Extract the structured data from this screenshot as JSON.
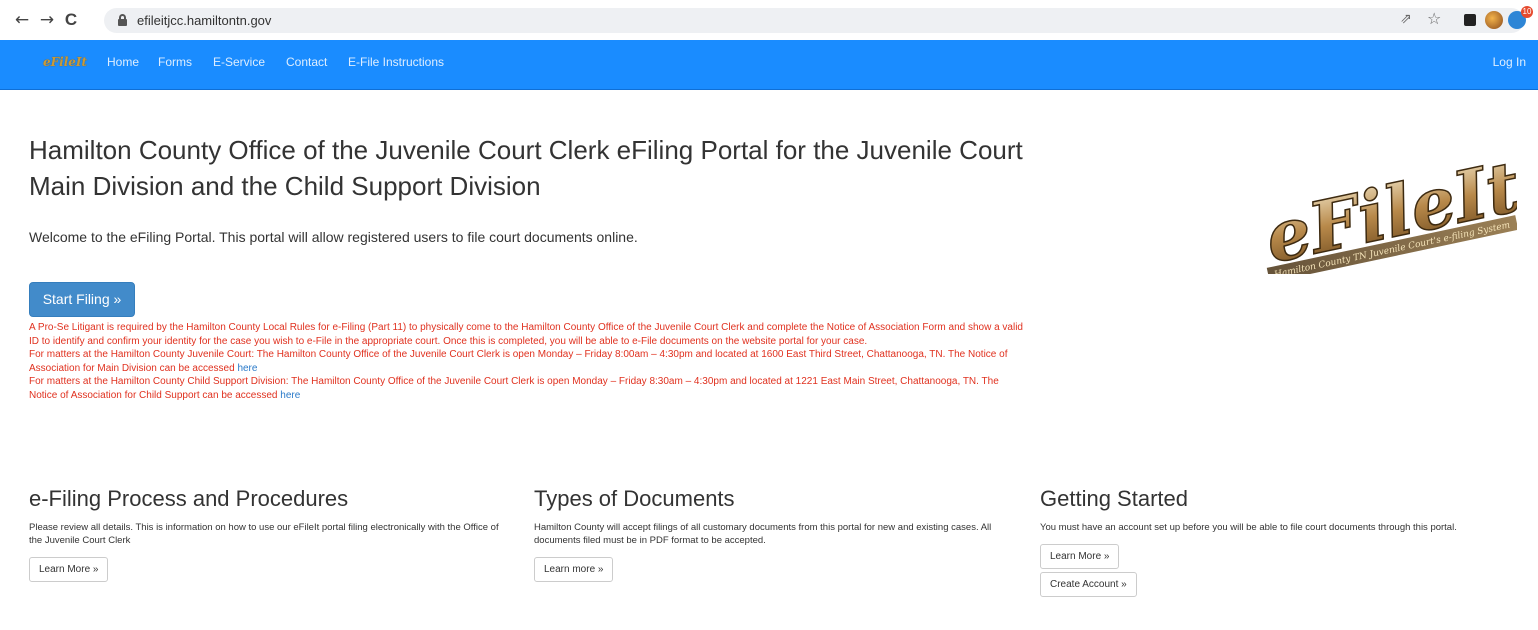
{
  "browser": {
    "url": "efileitjcc.hamiltontn.gov",
    "back": "←",
    "forward": "→",
    "reload": "C",
    "share": "⇗",
    "star": "☆",
    "ext_badge": "10"
  },
  "navbar": {
    "brand": "eFileIt",
    "links": [
      "Home",
      "Forms",
      "E-Service",
      "Contact",
      "E-File Instructions"
    ],
    "login": "Log In",
    "color": "#1a8cff"
  },
  "main": {
    "headline": "Hamilton County Office of the Juvenile Court Clerk eFiling Portal for the Juvenile Court Main Division and the Child Support Division",
    "welcome": "Welcome to the eFiling Portal. This portal will allow registered users to file court documents online.",
    "start_button": "Start Filing »",
    "notice": {
      "p1": "A Pro-Se Litigant is required by the Hamilton County Local Rules for e-Filing (Part 11) to physically come to the Hamilton County Office of the Juvenile Court Clerk and complete the Notice of Association Form and show a valid ID to identify and confirm your identity for the case you wish to e-File in the appropriate court. Once this is completed, you will be able to e-File documents on the website portal for your case.",
      "p2": "For matters at the Hamilton County Juvenile Court: The Hamilton County Office of the Juvenile Court Clerk is open Monday – Friday 8:00am – 4:30pm and located at 1600 East Third Street, Chattanooga, TN. The Notice of Association for Main Division can be accessed",
      "p2_link": "here",
      "p3": "For matters at the Hamilton County Child Support Division: The Hamilton County Office of the Juvenile Court Clerk is open Monday – Friday 8:30am – 4:30pm and located at 1221 East Main Street, Chattanooga, TN. The Notice of Association for Child Support can be accessed",
      "p3_link": "here"
    },
    "logo": {
      "title": "eFileIt",
      "tagline": "Hamilton County TN Juvenile Court's e-filing System"
    }
  },
  "columns": [
    {
      "title": "e-Filing Process and Procedures",
      "text": "Please review all details.  This is information on how to use our eFileIt portal filing electronically with the Office of the Juvenile Court Clerk",
      "button": "Learn More »"
    },
    {
      "title": "Types of Documents",
      "text": "Hamilton County will accept filings of all customary documents from this portal for new and existing cases. All documents filed must be in PDF format to be accepted.",
      "button": "Learn more »"
    },
    {
      "title": "Getting Started",
      "text": "You must have an account set up before you will be able to file court documents through this portal.",
      "button": "Learn More »",
      "button2": "Create Account »"
    }
  ]
}
